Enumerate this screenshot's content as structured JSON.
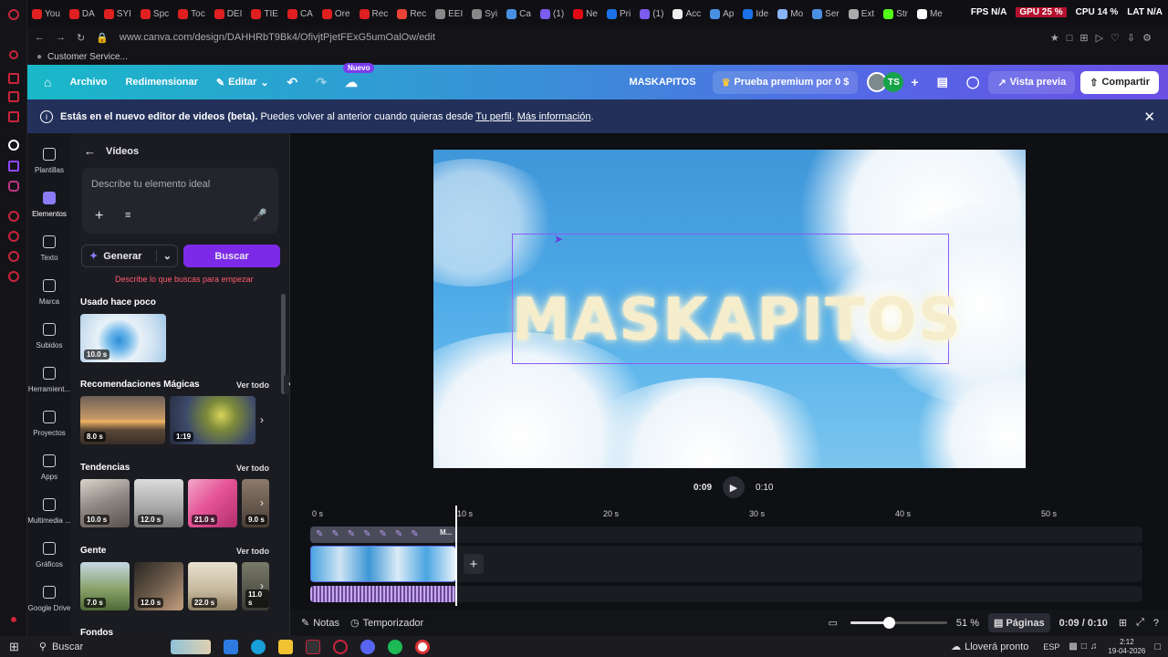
{
  "browser": {
    "tabs": [
      {
        "label": "You",
        "color": "#e02020"
      },
      {
        "label": "DA",
        "color": "#e02020"
      },
      {
        "label": "SYI",
        "color": "#e02020"
      },
      {
        "label": "Spc",
        "color": "#e02020"
      },
      {
        "label": "Toc",
        "color": "#e02020"
      },
      {
        "label": "DEI",
        "color": "#e02020"
      },
      {
        "label": "TIE",
        "color": "#e02020"
      },
      {
        "label": "CA",
        "color": "#e02020"
      },
      {
        "label": "Ore",
        "color": "#e02020"
      },
      {
        "label": "Rec",
        "color": "#e02020"
      },
      {
        "label": "Rec",
        "color": "#ea4335"
      },
      {
        "label": "EEI",
        "color": "#888888"
      },
      {
        "label": "Syi",
        "color": "#888888"
      },
      {
        "label": "Ca",
        "color": "#4a90e2"
      },
      {
        "label": "(1)",
        "color": "#7b5cf0"
      },
      {
        "label": "Ne",
        "color": "#e50914"
      },
      {
        "label": "Pri",
        "color": "#1a73e8"
      },
      {
        "label": "(1)",
        "color": "#7b5cf0"
      },
      {
        "label": "Acc",
        "color": "#eeeeee"
      },
      {
        "label": "Ap",
        "color": "#4a90e2"
      },
      {
        "label": "Ide",
        "color": "#1a73e8"
      },
      {
        "label": "Mo",
        "color": "#8ab4f8"
      },
      {
        "label": "Ser",
        "color": "#4a90e2"
      },
      {
        "label": "Ext",
        "color": "#aaaaaa"
      },
      {
        "label": "Str",
        "color": "#53fc18"
      },
      {
        "label": "Me",
        "color": "#ffffff"
      }
    ],
    "hud": {
      "fps": "FPS N/A",
      "gpu": "GPU 25 %",
      "cpu": "CPU 14 %",
      "lat": "LAT N/A"
    },
    "url": "www.canva.com/design/DAHHRbT9Bk4/OfivjtPjetFExG5umOalOw/edit",
    "bookmark": "Customer Service..."
  },
  "header": {
    "archivo": "Archivo",
    "redimensionar": "Redimensionar",
    "editar": "Editar",
    "nuevo_badge": "Nuevo",
    "design_name": "MASKAPITOS",
    "premium": "Prueba premium por 0 $",
    "avatar_initials": "TS",
    "preview": "Vista previa",
    "share": "Compartir"
  },
  "banner": {
    "bold": "Estás en el nuevo editor de videos (beta).",
    "text": "Puedes volver al anterior cuando quieras desde",
    "link1": "Tu perfil",
    "sep": ".",
    "link2": "Más información",
    "end": "."
  },
  "rail": [
    {
      "label": "Plantillas",
      "icon": "layout-icon"
    },
    {
      "label": "Elementos",
      "icon": "elements-icon"
    },
    {
      "label": "Texto",
      "icon": "text-icon"
    },
    {
      "label": "Marca",
      "icon": "brand-icon"
    },
    {
      "label": "Subidos",
      "icon": "upload-icon"
    },
    {
      "label": "Herramient...",
      "icon": "tools-icon"
    },
    {
      "label": "Proyectos",
      "icon": "folder-icon"
    },
    {
      "label": "Apps",
      "icon": "apps-icon"
    },
    {
      "label": "Multimedia ...",
      "icon": "media-icon"
    },
    {
      "label": "Gráficos",
      "icon": "graphics-icon"
    },
    {
      "label": "Google Drive",
      "icon": "drive-icon"
    }
  ],
  "panel": {
    "title": "Vídeos",
    "search_placeholder": "Describe tu elemento ideal",
    "generate": "Generar",
    "search_button": "Buscar",
    "hint": "Describe lo que buscas para empezar",
    "recent_title": "Usado hace poco",
    "recent": [
      {
        "duration": "10.0 s"
      }
    ],
    "magic_title": "Recomendaciones Mágicas",
    "see_all": "Ver todo",
    "magic": [
      {
        "duration": "8.0 s"
      },
      {
        "duration": "1:19"
      }
    ],
    "trends_title": "Tendencias",
    "trends": [
      {
        "duration": "10.0 s"
      },
      {
        "duration": "12.0 s"
      },
      {
        "duration": "21.0 s"
      },
      {
        "duration": "9.0 s"
      }
    ],
    "people_title": "Gente",
    "people": [
      {
        "duration": "7.0 s"
      },
      {
        "duration": "12.0 s"
      },
      {
        "duration": "22.0 s"
      },
      {
        "duration": "11.0 s"
      }
    ],
    "next_title": "Fondos"
  },
  "canvas": {
    "title_text": "MASKAPITOS"
  },
  "player": {
    "current": "0:09",
    "total": "0:10"
  },
  "timeline": {
    "ticks": [
      "0 s",
      "10 s",
      "20 s",
      "30 s",
      "40 s",
      "50 s"
    ],
    "clip_label": "M..."
  },
  "bottom": {
    "notes": "Notas",
    "timer": "Temporizador",
    "zoom": "51 %",
    "pages": "Páginas",
    "time": "0:09 / 0:10",
    "zoom_level": 0.4
  },
  "taskbar": {
    "search": "Buscar",
    "weather": "Lloverá pronto",
    "lang": "ESP",
    "time": "2:12",
    "date": "19-04-2026"
  }
}
